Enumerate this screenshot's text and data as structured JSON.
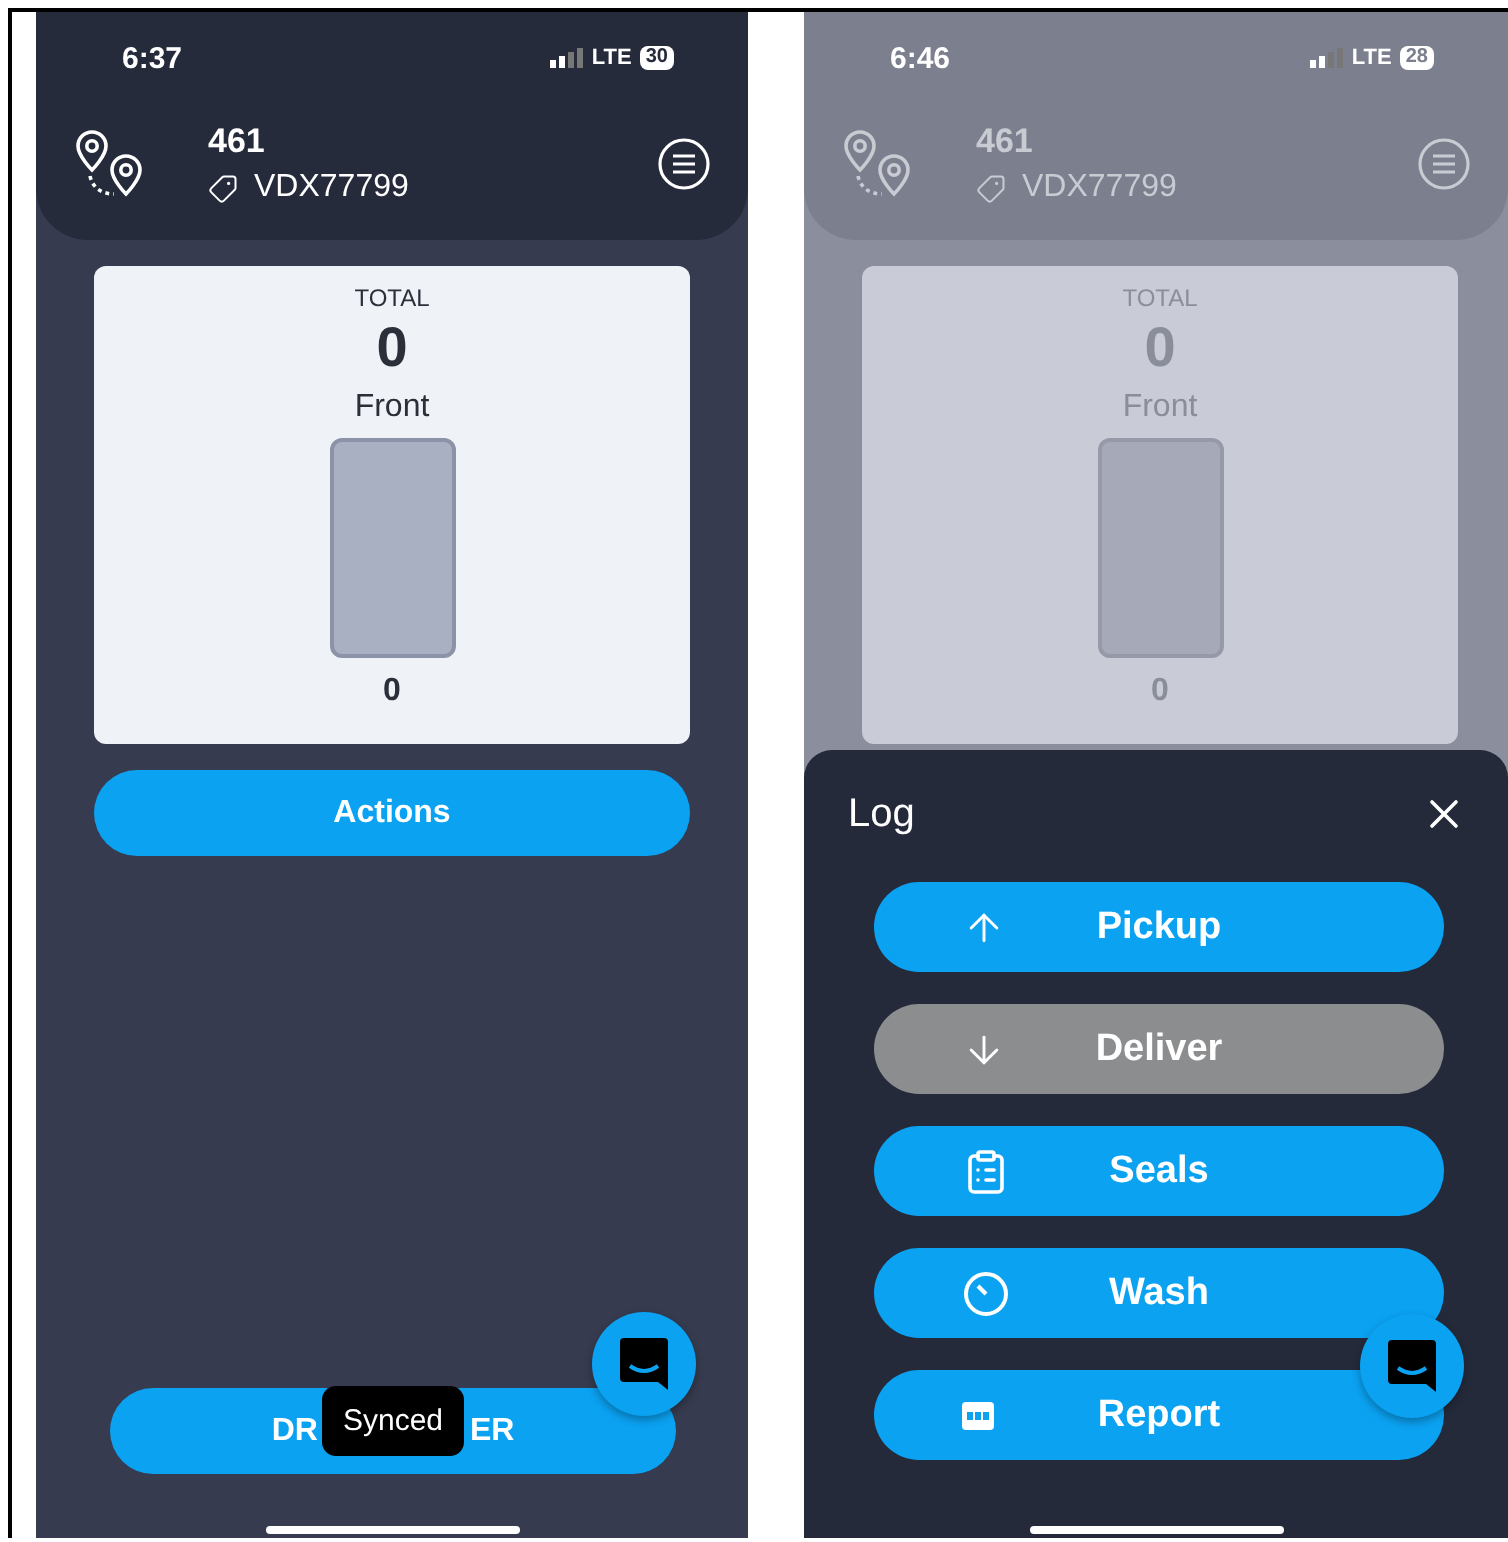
{
  "screens": [
    {
      "dimmed": false,
      "status": {
        "time": "6:37",
        "network": "LTE",
        "battery": "30"
      },
      "header": {
        "number": "461",
        "tag": "VDX77799"
      },
      "card": {
        "total_label": "TOTAL",
        "total": "0",
        "gauge_label": "Front",
        "gauge_value": "0"
      },
      "actions_button": {
        "label": "Actions"
      },
      "bottom_button": {
        "label_parts": [
          "DR",
          "ER"
        ]
      },
      "toast": {
        "text": "Synced"
      }
    },
    {
      "dimmed": true,
      "status": {
        "time": "6:46",
        "network": "LTE",
        "battery": "28"
      },
      "header": {
        "number": "461",
        "tag": "VDX77799"
      },
      "card": {
        "total_label": "TOTAL",
        "total": "0",
        "gauge_label": "Front",
        "gauge_value": "0"
      },
      "sheet": {
        "title": "Log",
        "buttons": [
          {
            "label": "Pickup",
            "kind": "up",
            "disabled": false
          },
          {
            "label": "Deliver",
            "kind": "down",
            "disabled": true
          },
          {
            "label": "Seals",
            "kind": "clipboard",
            "disabled": false
          },
          {
            "label": "Wash",
            "kind": "timer",
            "disabled": false
          },
          {
            "label": "Report",
            "kind": "pdf",
            "disabled": false
          }
        ]
      }
    }
  ]
}
